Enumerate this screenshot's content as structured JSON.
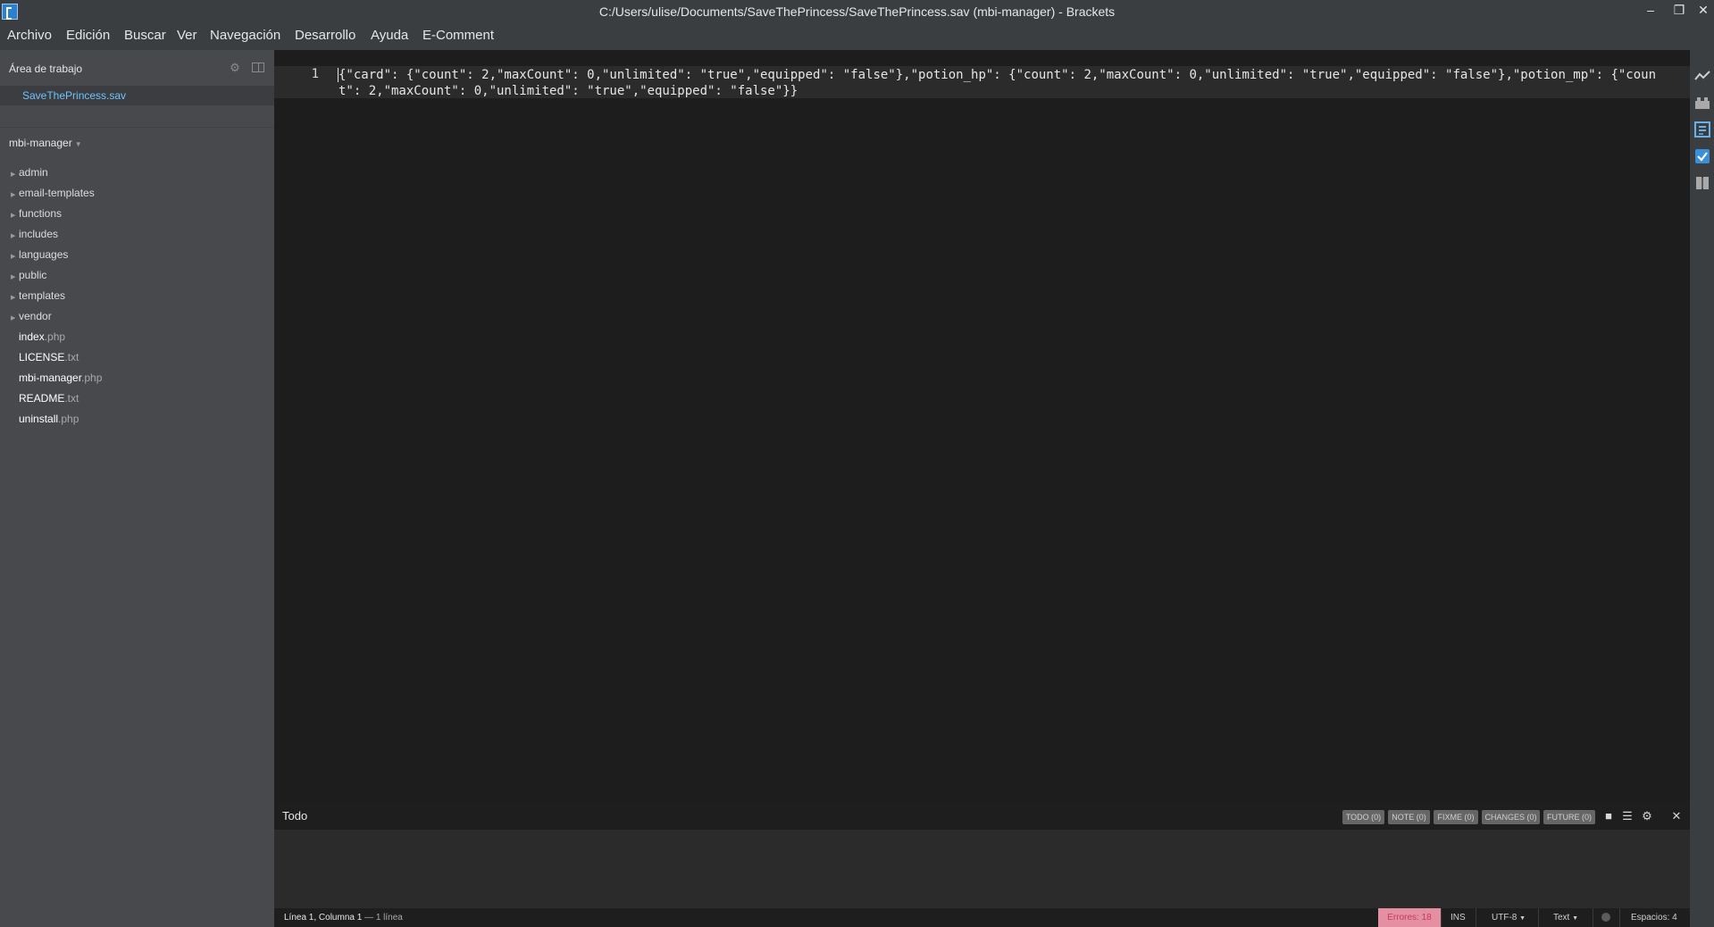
{
  "window": {
    "title": "C:/Users/ulise/Documents/SaveThePrincess/SaveThePrincess.sav (mbi-manager) - Brackets",
    "minimize_label": "–",
    "maximize_label": "❐",
    "close_label": "✕"
  },
  "menu": {
    "items": [
      "Archivo",
      "Edición",
      "Buscar",
      "Ver",
      "Navegación",
      "Desarrollo",
      "Ayuda",
      "E-Comment"
    ]
  },
  "sidebar": {
    "workspace_header": "Área de trabajo",
    "workspace_file": "SaveThePrincess.sav",
    "project_name": "mbi-manager",
    "folders": [
      "admin",
      "email-templates",
      "functions",
      "includes",
      "languages",
      "public",
      "templates",
      "vendor"
    ],
    "files": [
      {
        "name": "index",
        "ext": ".php"
      },
      {
        "name": "LICENSE",
        "ext": ".txt"
      },
      {
        "name": "mbi-manager",
        "ext": ".php"
      },
      {
        "name": "README",
        "ext": ".txt"
      },
      {
        "name": "uninstall",
        "ext": ".php"
      }
    ]
  },
  "editor": {
    "line_number": "1",
    "content": "{\"card\": {\"count\": 2,\"maxCount\": 0,\"unlimited\": \"true\",\"equipped\": \"false\"},\"potion_hp\": {\"count\": 2,\"maxCount\": 0,\"unlimited\": \"true\",\"equipped\": \"false\"},\"potion_mp\": {\"count\": 2,\"maxCount\": 0,\"unlimited\": \"true\",\"equipped\": \"false\"}}"
  },
  "todo_panel": {
    "title": "Todo",
    "tags": [
      "TODO (0)",
      "NOTE (0)",
      "FIXME (0)",
      "CHANGES (0)",
      "FUTURE (0)"
    ]
  },
  "statusbar": {
    "position": "Línea 1, Columna 1",
    "lines": "— 1 línea",
    "errors": "Errores: 18",
    "mode": "INS",
    "encoding": "UTF-8",
    "language": "Text",
    "indent": "Espacios: 4"
  },
  "colors": {
    "chrome": "#3b3e40",
    "sidebar": "#47494c",
    "editor_bg": "#1d1d1d",
    "active_file": "#6ec3ff",
    "errors_badge": "#e48fa2"
  }
}
